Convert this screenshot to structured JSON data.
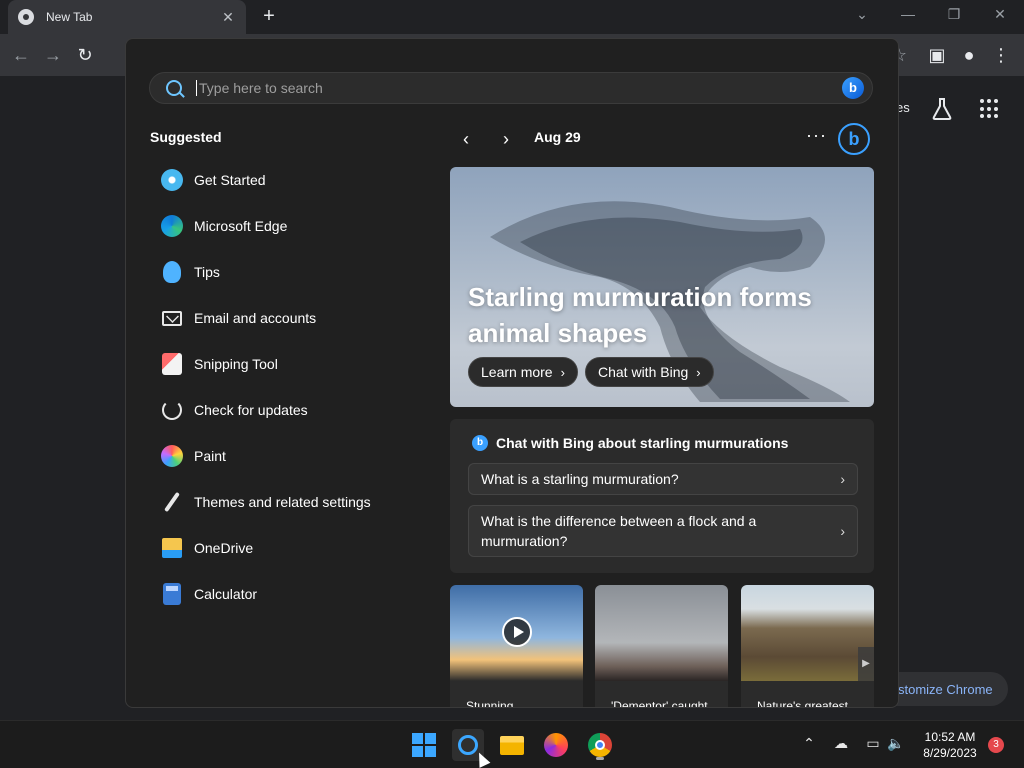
{
  "browser": {
    "tab_title": "New Tab",
    "new_tab_symbol": "+",
    "tab_close_symbol": "✕",
    "ntp_link_fragment": "es",
    "customize_label": "stomize Chrome"
  },
  "flyout": {
    "search": {
      "placeholder": "Type here to search"
    },
    "suggested": {
      "title": "Suggested",
      "items": [
        {
          "label": "Get Started",
          "icon": "get-started-icon"
        },
        {
          "label": "Microsoft Edge",
          "icon": "edge-icon"
        },
        {
          "label": "Tips",
          "icon": "tips-icon"
        },
        {
          "label": "Email and accounts",
          "icon": "mail-icon"
        },
        {
          "label": "Snipping Tool",
          "icon": "snipping-tool-icon"
        },
        {
          "label": "Check for updates",
          "icon": "refresh-icon"
        },
        {
          "label": "Paint",
          "icon": "paint-icon"
        },
        {
          "label": "Themes and related settings",
          "icon": "brush-icon"
        },
        {
          "label": "OneDrive",
          "icon": "onedrive-icon"
        },
        {
          "label": "Calculator",
          "icon": "calculator-icon"
        }
      ]
    },
    "news": {
      "date": "Aug 29",
      "more_symbol": "···",
      "hero_title": "Starling murmuration forms animal shapes",
      "learn_more": "Learn more",
      "chat_with_bing": "Chat with Bing"
    },
    "chat": {
      "title": "Chat with Bing about starling murmurations",
      "questions": [
        "What is a starling murmuration?",
        "What is the difference between a flock and a murmuration?"
      ]
    },
    "thumbnails": [
      {
        "caption": "Stunning"
      },
      {
        "caption": "'Dementor' caught"
      },
      {
        "caption": "Nature's greatest"
      }
    ]
  },
  "taskbar": {
    "time": "10:52 AM",
    "date": "8/29/2023",
    "notification_count": "3"
  },
  "colors": {
    "accent": "#3ba7ff",
    "flyout_bg": "#202020",
    "badge": "#e5484d"
  }
}
